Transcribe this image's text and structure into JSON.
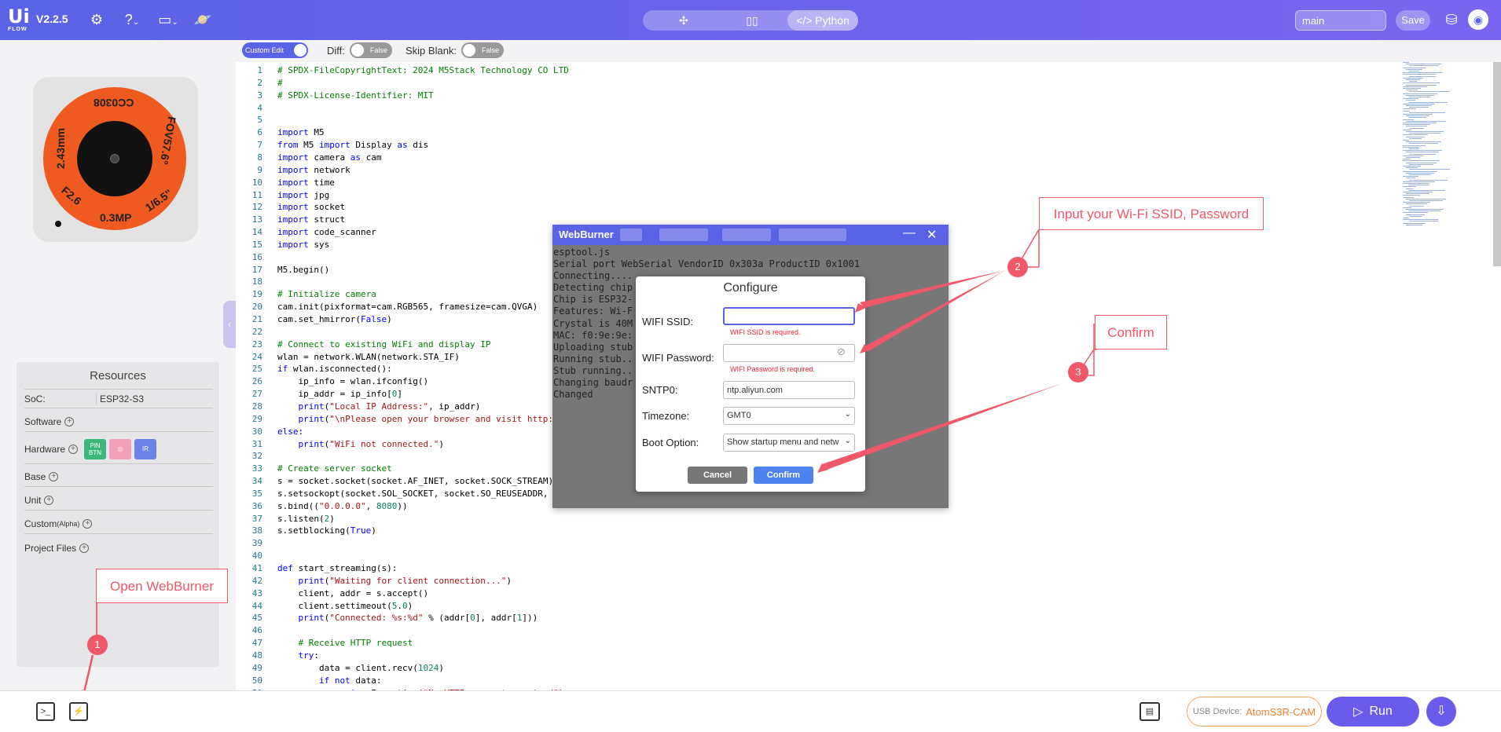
{
  "app": {
    "logo_top": "Ui",
    "logo_bottom": "FLOW",
    "version": "V2.2.5",
    "view_tabs": [
      {
        "name": "blocks",
        "icon": "puzzle-icon"
      },
      {
        "name": "split",
        "icon": "split-view-icon"
      },
      {
        "name": "python",
        "label": "</> Python"
      }
    ],
    "branch": "main",
    "save_label": "Save"
  },
  "toolbar": {
    "custom_edit_label": "Custom Edit",
    "diff_label": "Diff:",
    "diff_value": "False",
    "skip_blank_label": "Skip Blank:",
    "skip_blank_value": "False"
  },
  "device_image": {
    "lens_labels": [
      "CC0308",
      "FOV57.6°",
      "1/6.5\"",
      "0.3MP",
      "F2.6",
      "2.43mm"
    ]
  },
  "resources": {
    "title": "Resources",
    "soc_label": "SoC:",
    "soc_value": "ESP32-S3",
    "software": "Software",
    "hardware": "Hardware",
    "hw_badges": [
      "PIN BTN",
      "◎",
      "IR"
    ],
    "base": "Base",
    "unit": "Unit",
    "custom": "Custom",
    "custom_suffix": "(Alpha)",
    "project_files": "Project Files"
  },
  "code_lines": [
    "# SPDX-FileCopyrightText: 2024 M5Stack Technology CO LTD",
    "#",
    "# SPDX-License-Identifier: MIT",
    "",
    "",
    "import M5",
    "from M5 import Display as dis",
    "import camera as cam",
    "import network",
    "import time",
    "import jpg",
    "import socket",
    "import struct",
    "import code_scanner",
    "import sys",
    "",
    "M5.begin()",
    "",
    "# Initialize camera",
    "cam.init(pixformat=cam.RGB565, framesize=cam.QVGA)",
    "cam.set_hmirror(False)",
    "",
    "# Connect to existing WiFi and display IP",
    "wlan = network.WLAN(network.STA_IF)",
    "if wlan.isconnected():",
    "    ip_info = wlan.ifconfig()",
    "    ip_addr = ip_info[0]",
    "    print(\"Local IP Address:\", ip_addr)",
    "    print(\"\\nPlease open your browser and visit http://",
    "else:",
    "    print(\"WiFi not connected.\")",
    "",
    "# Create server socket",
    "s = socket.socket(socket.AF_INET, socket.SOCK_STREAM)",
    "s.setsockopt(socket.SOL_SOCKET, socket.SO_REUSEADDR, Tr",
    "s.bind((\"0.0.0.0\", 8080))",
    "s.listen(2)",
    "s.setblocking(True)",
    "",
    "",
    "def start_streaming(s):",
    "    print(\"Waiting for client connection...\")",
    "    client, addr = s.accept()",
    "    client.settimeout(5.0)",
    "    print(\"Connected: %s:%d\" % (addr[0], addr[1]))",
    "",
    "    # Receive HTTP request",
    "    try:",
    "        data = client.recv(1024)",
    "        if not data:",
    "            raise Exception(\"No HTTP request received\")"
  ],
  "webburner": {
    "title": "WebBurner",
    "log": [
      "esptool.js",
      "Serial port WebSerial VendorID 0x303a ProductID 0x1001",
      "Connecting....",
      "Detecting chip",
      "Chip is ESP32-",
      "Features: Wi-F",
      "Crystal is 40M",
      "MAC: f0:9e:9e:",
      "Uploading stub",
      "Running stub..",
      "Stub running..",
      "Changing baudr",
      "Changed"
    ]
  },
  "configure": {
    "title": "Configure",
    "ssid_label": "WIFI SSID:",
    "ssid_value": "",
    "ssid_error": "WIFI SSID is required.",
    "password_label": "WIFI Password:",
    "password_value": "",
    "password_error": "WIFI Password is required.",
    "sntp_label": "SNTP0:",
    "sntp_value": "ntp.aliyun.com",
    "timezone_label": "Timezone:",
    "timezone_value": "GMT0",
    "boot_label": "Boot Option:",
    "boot_value": "Show startup menu and netw",
    "cancel_label": "Cancel",
    "confirm_label": "Confirm"
  },
  "annotations": {
    "wifi_callout": "Input your Wi-Fi SSID, Password",
    "confirm_callout": "Confirm",
    "webburner_callout": "Open WebBurner",
    "step1": "1",
    "step2": "2",
    "step3": "3",
    "color": "#ee5868"
  },
  "bottom": {
    "usb_label": "USB Device:",
    "usb_device": "AtomS3R-CAM",
    "run_label": "Run"
  },
  "colors": {
    "accent": "#5a63e6",
    "run": "#6a5cea",
    "usb_border": "#f4a35c",
    "keyword": "#0000ff",
    "comment": "#008000",
    "string": "#a31515",
    "number": "#098658"
  }
}
